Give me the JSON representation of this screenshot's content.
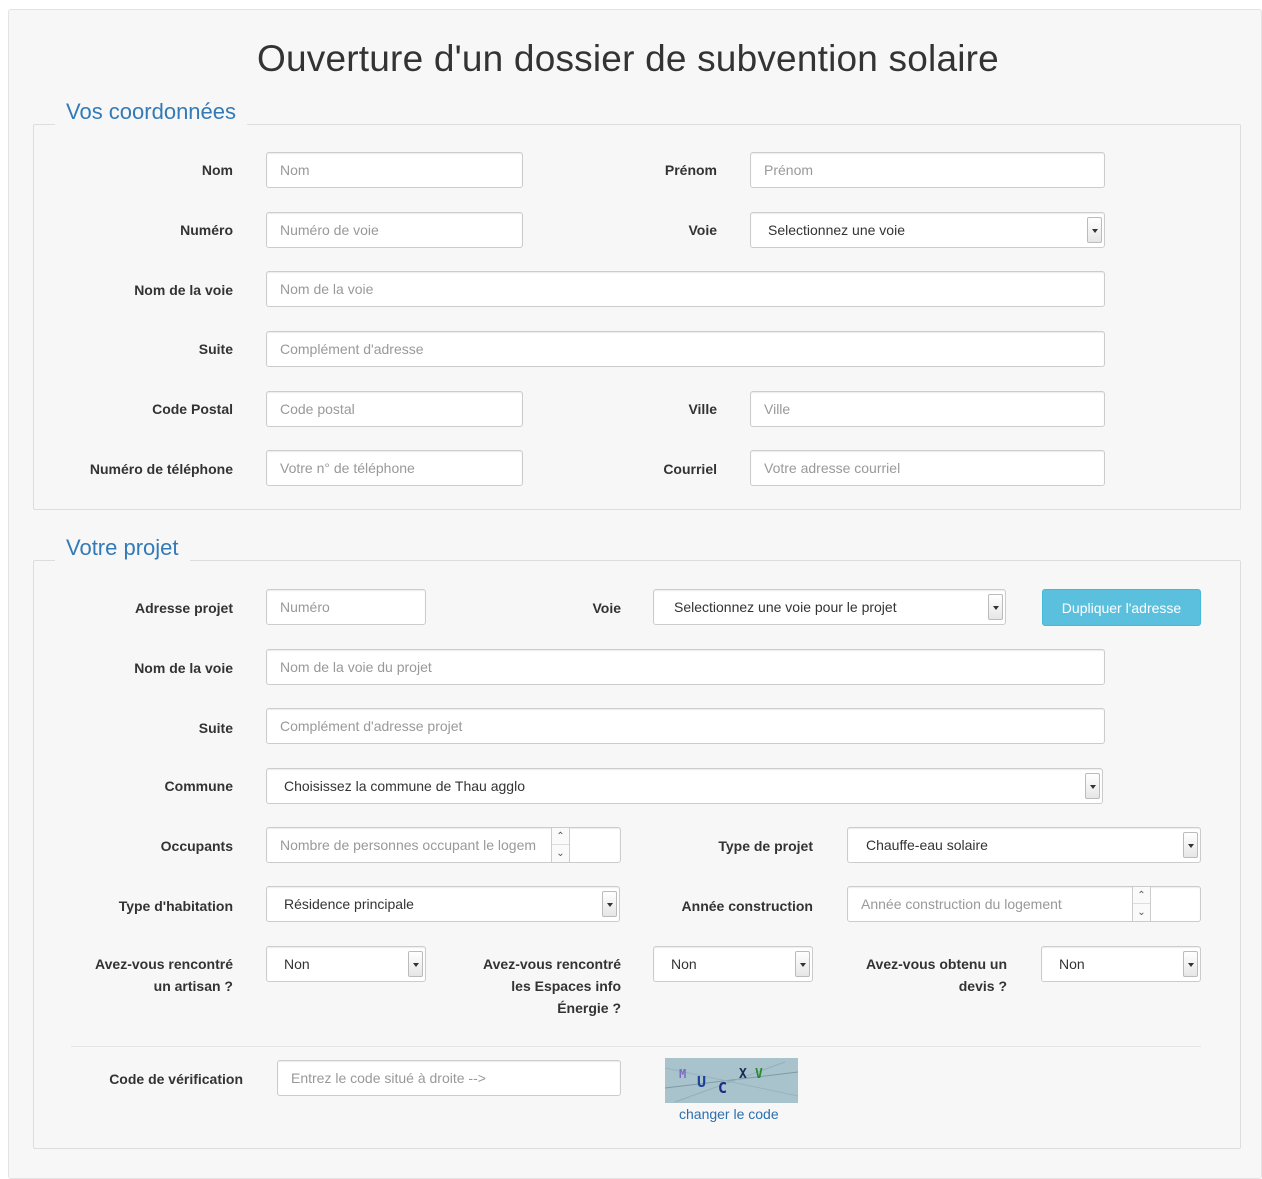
{
  "title": "Ouverture d'un dossier de subvention solaire",
  "coordonnees": {
    "legend": "Vos coordonnées",
    "nom": {
      "label": "Nom",
      "placeholder": "Nom"
    },
    "prenom": {
      "label": "Prénom",
      "placeholder": "Prénom"
    },
    "numero": {
      "label": "Numéro",
      "placeholder": "Numéro de voie"
    },
    "voie": {
      "label": "Voie",
      "value": "Selectionnez une voie"
    },
    "nom_voie": {
      "label": "Nom de la voie",
      "placeholder": "Nom de la voie"
    },
    "suite": {
      "label": "Suite",
      "placeholder": "Complément d'adresse"
    },
    "code_postal": {
      "label": "Code Postal",
      "placeholder": "Code postal"
    },
    "ville": {
      "label": "Ville",
      "placeholder": "Ville"
    },
    "telephone": {
      "label": "Numéro de téléphone",
      "placeholder": "Votre n° de téléphone"
    },
    "courriel": {
      "label": "Courriel",
      "placeholder": "Votre adresse courriel"
    }
  },
  "projet": {
    "legend": "Votre projet",
    "adresse": {
      "label": "Adresse projet",
      "placeholder": "Numéro"
    },
    "voie": {
      "label": "Voie",
      "value": "Selectionnez une voie pour le projet"
    },
    "dupliquer_label": "Dupliquer l'adresse",
    "nom_voie": {
      "label": "Nom de la voie",
      "placeholder": "Nom de la voie du projet"
    },
    "suite": {
      "label": "Suite",
      "placeholder": "Complément d'adresse projet"
    },
    "commune": {
      "label": "Commune",
      "value": "Choisissez la commune de Thau agglo"
    },
    "occupants": {
      "label": "Occupants",
      "placeholder": "Nombre de personnes occupant le logem"
    },
    "type_projet": {
      "label": "Type de projet",
      "value": "Chauffe-eau solaire"
    },
    "type_habitation": {
      "label": "Type d'habitation",
      "value": "Résidence principale"
    },
    "annee": {
      "label": "Année construction",
      "placeholder": "Année construction du logement"
    },
    "artisan": {
      "label_1": "Avez-vous rencontré",
      "label_2": "un artisan ?",
      "value": "Non"
    },
    "espaces": {
      "label_1": "Avez-vous rencontré",
      "label_2": "les Espaces info",
      "label_3": "Énergie ?",
      "value": "Non"
    },
    "devis": {
      "label_1": "Avez-vous obtenu un",
      "label_2": "devis ?",
      "value": "Non"
    },
    "verification": {
      "label": "Code de vérification",
      "placeholder": "Entrez le code situé à droite -->"
    },
    "captcha": {
      "chars": [
        "M",
        "U",
        "C",
        "X",
        "V"
      ]
    },
    "changer_code": "changer le code"
  },
  "colors": {
    "accent": "#337ab7",
    "button_info": "#5bc0de",
    "captcha_bg": "#a9c3cc"
  }
}
